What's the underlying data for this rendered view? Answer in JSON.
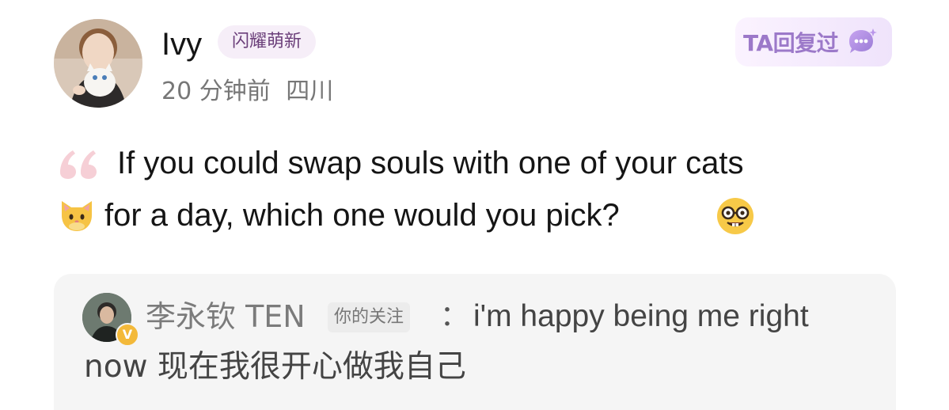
{
  "post": {
    "author": {
      "name": "Ivy",
      "level_badge": "闪耀萌新",
      "time_ago": "20 分钟前",
      "location": "四川",
      "avatar_icon": "avatar-girl-with-cat"
    },
    "replied_badge": {
      "label": "TA回复过",
      "icon": "chat-bubble-icon",
      "color": "#9c79c9"
    },
    "body": {
      "line1": "If you could swap souls with one of your cats",
      "line2": "for a day, which one would you pick?",
      "quote_icon": "quote-mark-icon",
      "emojis": [
        "cat-face",
        "nerd-face"
      ]
    },
    "reply": {
      "author_name": "李永钦 TEN",
      "follow_tag": "你的关注",
      "separator": "：",
      "text_line1": "i'm happy being me right",
      "text_line2": "now 现在我很开心做我自己",
      "verified_icon": "verified-v-icon"
    }
  }
}
